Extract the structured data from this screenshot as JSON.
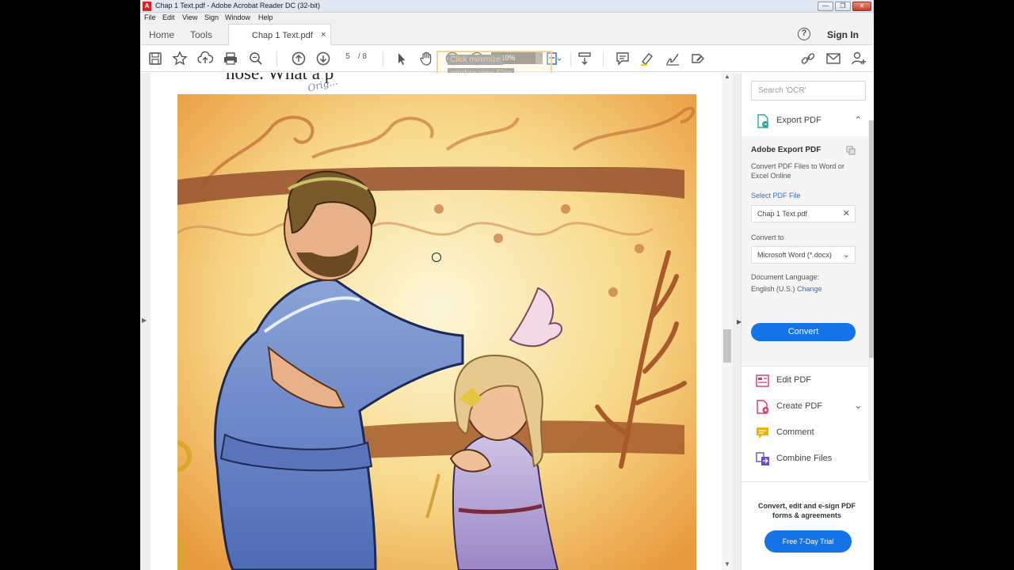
{
  "window": {
    "title": "Chap 1 Text.pdf - Adobe Acrobat Reader DC (32-bit)"
  },
  "menu": [
    "File",
    "Edit",
    "View",
    "Sign",
    "Window",
    "Help"
  ],
  "tabs": {
    "home": "Home",
    "tools": "Tools",
    "document": "Chap 1 Text.pdf",
    "close": "×"
  },
  "header": {
    "help_icon": "?",
    "sign_in": "Sign In"
  },
  "toolbar": {
    "page_current": "5",
    "page_total": "/ 8",
    "zoom": "110%",
    "icons": [
      "save-icon",
      "bookmark-star-icon",
      "upload-icon",
      "print-icon",
      "search-zoom-icon",
      "page-up-icon",
      "page-down-icon",
      "select-cursor-icon",
      "hand-icon",
      "zoom-out-icon",
      "zoom-in-icon",
      "fit-page-icon",
      "scroll-mode-icon",
      "comment-icon",
      "highlight-icon",
      "sign-icon",
      "fill-sign-icon",
      "share-link-icon",
      "email-icon",
      "add-user-icon"
    ]
  },
  "tooltip": {
    "line1": "Click minimize",
    "line2": "window view Fixe"
  },
  "document": {
    "visible_text": "nose. What a p",
    "scribble": "Orig..."
  },
  "right_pane": {
    "search_placeholder": "Search 'OCR'",
    "export_pdf": "Export PDF",
    "export_heading": "Adobe Export PDF",
    "export_desc": "Convert PDF Files to Word or Excel Online",
    "select_file": "Select PDF File",
    "file_name": "Chap 1 Text.pdf",
    "convert_to_label": "Convert to",
    "convert_to_value": "Microsoft Word (*.docx)",
    "doc_language_label": "Document Language:",
    "doc_language_value": "English (U.S.)",
    "change": "Change",
    "convert_button": "Convert",
    "tools": [
      "Edit PDF",
      "Create PDF",
      "Comment",
      "Combine Files"
    ],
    "promo_text": "Convert, edit and e-sign PDF forms & agreements",
    "trial_button": "Free 7-Day Trial"
  },
  "colors": {
    "accent": "#1473e6",
    "export_icon": "#2aa6a0",
    "edit_icon": "#e0356a",
    "comment_icon": "#f0b400",
    "combine_icon": "#6c4ad6"
  }
}
